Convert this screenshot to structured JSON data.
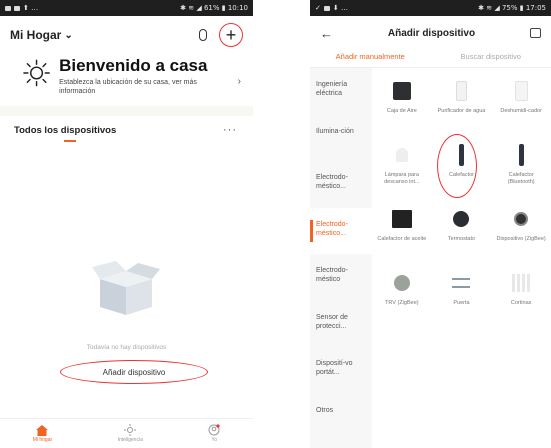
{
  "left": {
    "status": {
      "time": "10:10",
      "battery": "61%"
    },
    "header": {
      "home_name": "Mi Hogar",
      "chevron": "⌄"
    },
    "welcome": {
      "title": "Bienvenido a casa",
      "subtitle": "Establezca la ubicación de su casa, ver más información"
    },
    "devices_title": "Todos los dispositivos",
    "empty_text": "Todavía no hay dispositivos",
    "add_button": "Añadir dispositivo",
    "tabs": [
      {
        "label": "Mi hogar",
        "icon": "home-icon"
      },
      {
        "label": "Inteligencia",
        "icon": "sun-icon"
      },
      {
        "label": "Yo",
        "icon": "profile-icon"
      }
    ]
  },
  "right": {
    "status": {
      "time": "17:05",
      "battery": "75%"
    },
    "title": "Añadir dispositivo",
    "tabs": [
      "Añadir manualmente",
      "Buscar dispositivo"
    ],
    "categories": [
      "Ingeniería eléctrica",
      "Ilumina-ción",
      "Electrodo-méstico...",
      "Electrodo-méstico...",
      "Electrodo-méstico",
      "Sensor de protecci...",
      "Disposití-vo portát...",
      "Otros"
    ],
    "devices": [
      {
        "label": "Caja de Aire",
        "icon": "air-box-icon"
      },
      {
        "label": "Purificador de agua",
        "icon": "water-purifier-icon"
      },
      {
        "label": "Deshumidi-cador",
        "icon": "dehumidifier-icon"
      },
      {
        "label": "Lámpara para descanso int...",
        "icon": "lamp-icon"
      },
      {
        "label": "Calefactor",
        "icon": "heater-icon"
      },
      {
        "label": "Calefactor (Bluetooth)",
        "icon": "heater-bluetooth-icon"
      },
      {
        "label": "Calefactor de aceite",
        "icon": "oil-heater-icon"
      },
      {
        "label": "Termostato",
        "icon": "thermostat-icon"
      },
      {
        "label": "Dispositivo (ZigBee)",
        "icon": "zigbee-device-icon"
      },
      {
        "label": "TRV (ZigBee)",
        "icon": "trv-icon"
      },
      {
        "label": "Puerta",
        "icon": "door-icon"
      },
      {
        "label": "Cortinas",
        "icon": "curtain-icon"
      }
    ]
  }
}
